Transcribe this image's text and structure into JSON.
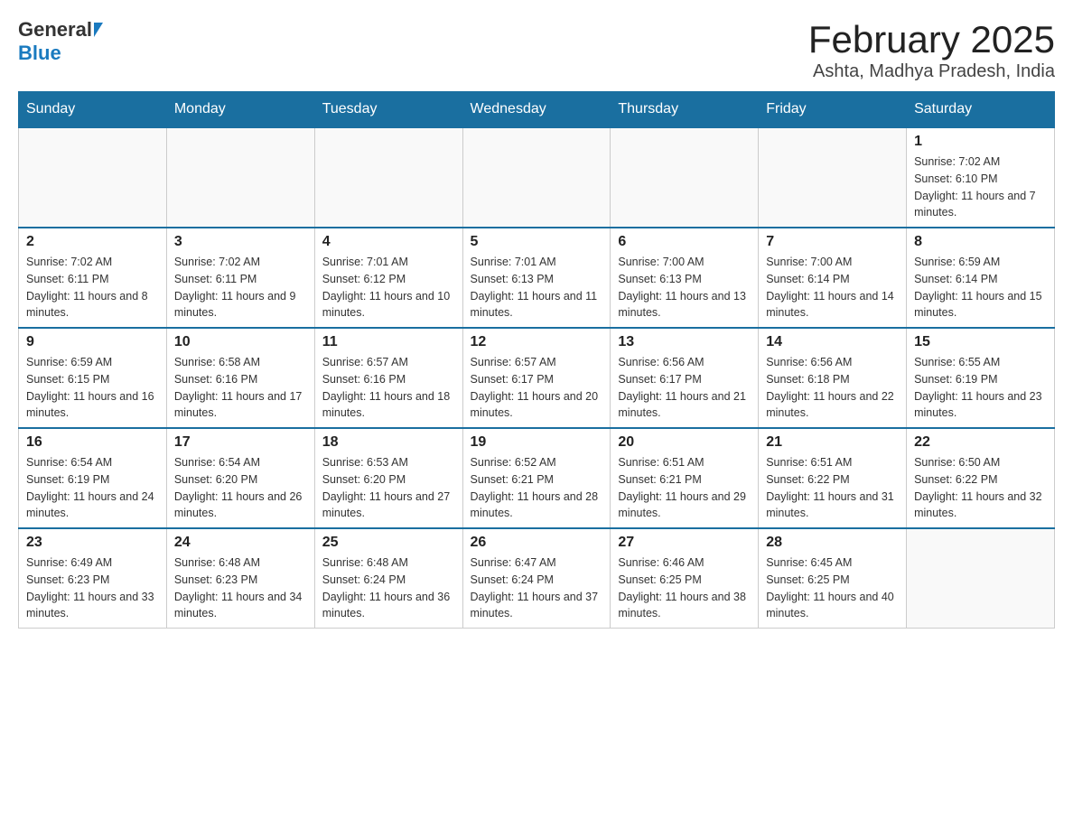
{
  "logo": {
    "general": "General",
    "blue": "Blue"
  },
  "title": "February 2025",
  "location": "Ashta, Madhya Pradesh, India",
  "days_of_week": [
    "Sunday",
    "Monday",
    "Tuesday",
    "Wednesday",
    "Thursday",
    "Friday",
    "Saturday"
  ],
  "weeks": [
    [
      {
        "day": "",
        "info": ""
      },
      {
        "day": "",
        "info": ""
      },
      {
        "day": "",
        "info": ""
      },
      {
        "day": "",
        "info": ""
      },
      {
        "day": "",
        "info": ""
      },
      {
        "day": "",
        "info": ""
      },
      {
        "day": "1",
        "info": "Sunrise: 7:02 AM\nSunset: 6:10 PM\nDaylight: 11 hours and 7 minutes."
      }
    ],
    [
      {
        "day": "2",
        "info": "Sunrise: 7:02 AM\nSunset: 6:11 PM\nDaylight: 11 hours and 8 minutes."
      },
      {
        "day": "3",
        "info": "Sunrise: 7:02 AM\nSunset: 6:11 PM\nDaylight: 11 hours and 9 minutes."
      },
      {
        "day": "4",
        "info": "Sunrise: 7:01 AM\nSunset: 6:12 PM\nDaylight: 11 hours and 10 minutes."
      },
      {
        "day": "5",
        "info": "Sunrise: 7:01 AM\nSunset: 6:13 PM\nDaylight: 11 hours and 11 minutes."
      },
      {
        "day": "6",
        "info": "Sunrise: 7:00 AM\nSunset: 6:13 PM\nDaylight: 11 hours and 13 minutes."
      },
      {
        "day": "7",
        "info": "Sunrise: 7:00 AM\nSunset: 6:14 PM\nDaylight: 11 hours and 14 minutes."
      },
      {
        "day": "8",
        "info": "Sunrise: 6:59 AM\nSunset: 6:14 PM\nDaylight: 11 hours and 15 minutes."
      }
    ],
    [
      {
        "day": "9",
        "info": "Sunrise: 6:59 AM\nSunset: 6:15 PM\nDaylight: 11 hours and 16 minutes."
      },
      {
        "day": "10",
        "info": "Sunrise: 6:58 AM\nSunset: 6:16 PM\nDaylight: 11 hours and 17 minutes."
      },
      {
        "day": "11",
        "info": "Sunrise: 6:57 AM\nSunset: 6:16 PM\nDaylight: 11 hours and 18 minutes."
      },
      {
        "day": "12",
        "info": "Sunrise: 6:57 AM\nSunset: 6:17 PM\nDaylight: 11 hours and 20 minutes."
      },
      {
        "day": "13",
        "info": "Sunrise: 6:56 AM\nSunset: 6:17 PM\nDaylight: 11 hours and 21 minutes."
      },
      {
        "day": "14",
        "info": "Sunrise: 6:56 AM\nSunset: 6:18 PM\nDaylight: 11 hours and 22 minutes."
      },
      {
        "day": "15",
        "info": "Sunrise: 6:55 AM\nSunset: 6:19 PM\nDaylight: 11 hours and 23 minutes."
      }
    ],
    [
      {
        "day": "16",
        "info": "Sunrise: 6:54 AM\nSunset: 6:19 PM\nDaylight: 11 hours and 24 minutes."
      },
      {
        "day": "17",
        "info": "Sunrise: 6:54 AM\nSunset: 6:20 PM\nDaylight: 11 hours and 26 minutes."
      },
      {
        "day": "18",
        "info": "Sunrise: 6:53 AM\nSunset: 6:20 PM\nDaylight: 11 hours and 27 minutes."
      },
      {
        "day": "19",
        "info": "Sunrise: 6:52 AM\nSunset: 6:21 PM\nDaylight: 11 hours and 28 minutes."
      },
      {
        "day": "20",
        "info": "Sunrise: 6:51 AM\nSunset: 6:21 PM\nDaylight: 11 hours and 29 minutes."
      },
      {
        "day": "21",
        "info": "Sunrise: 6:51 AM\nSunset: 6:22 PM\nDaylight: 11 hours and 31 minutes."
      },
      {
        "day": "22",
        "info": "Sunrise: 6:50 AM\nSunset: 6:22 PM\nDaylight: 11 hours and 32 minutes."
      }
    ],
    [
      {
        "day": "23",
        "info": "Sunrise: 6:49 AM\nSunset: 6:23 PM\nDaylight: 11 hours and 33 minutes."
      },
      {
        "day": "24",
        "info": "Sunrise: 6:48 AM\nSunset: 6:23 PM\nDaylight: 11 hours and 34 minutes."
      },
      {
        "day": "25",
        "info": "Sunrise: 6:48 AM\nSunset: 6:24 PM\nDaylight: 11 hours and 36 minutes."
      },
      {
        "day": "26",
        "info": "Sunrise: 6:47 AM\nSunset: 6:24 PM\nDaylight: 11 hours and 37 minutes."
      },
      {
        "day": "27",
        "info": "Sunrise: 6:46 AM\nSunset: 6:25 PM\nDaylight: 11 hours and 38 minutes."
      },
      {
        "day": "28",
        "info": "Sunrise: 6:45 AM\nSunset: 6:25 PM\nDaylight: 11 hours and 40 minutes."
      },
      {
        "day": "",
        "info": ""
      }
    ]
  ]
}
